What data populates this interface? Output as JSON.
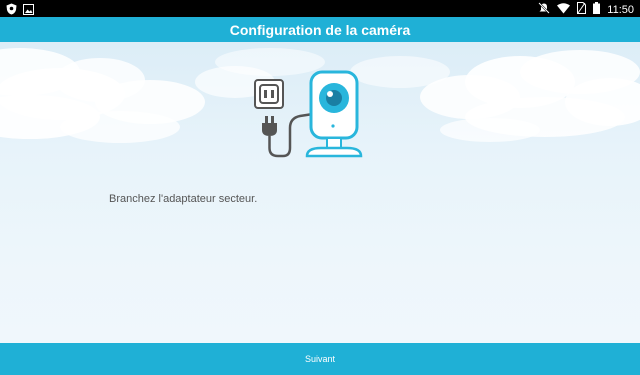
{
  "status_bar": {
    "time": "11:50",
    "left_icons": [
      "shield-icon",
      "image-icon"
    ],
    "right_icons": [
      "mute-icon",
      "wifi-icon",
      "sim-icon",
      "battery-icon"
    ]
  },
  "app_bar": {
    "title": "Configuration de la caméra"
  },
  "main": {
    "instruction": "Branchez l'adaptateur secteur.",
    "illustration": "camera-plug-illustration"
  },
  "bottom": {
    "next_label": "Suivant"
  },
  "colors": {
    "accent": "#1fb0d6",
    "status_bar": "#000000",
    "text": "#555555",
    "cloud": "#ffffff",
    "plug_gray": "#555555"
  }
}
